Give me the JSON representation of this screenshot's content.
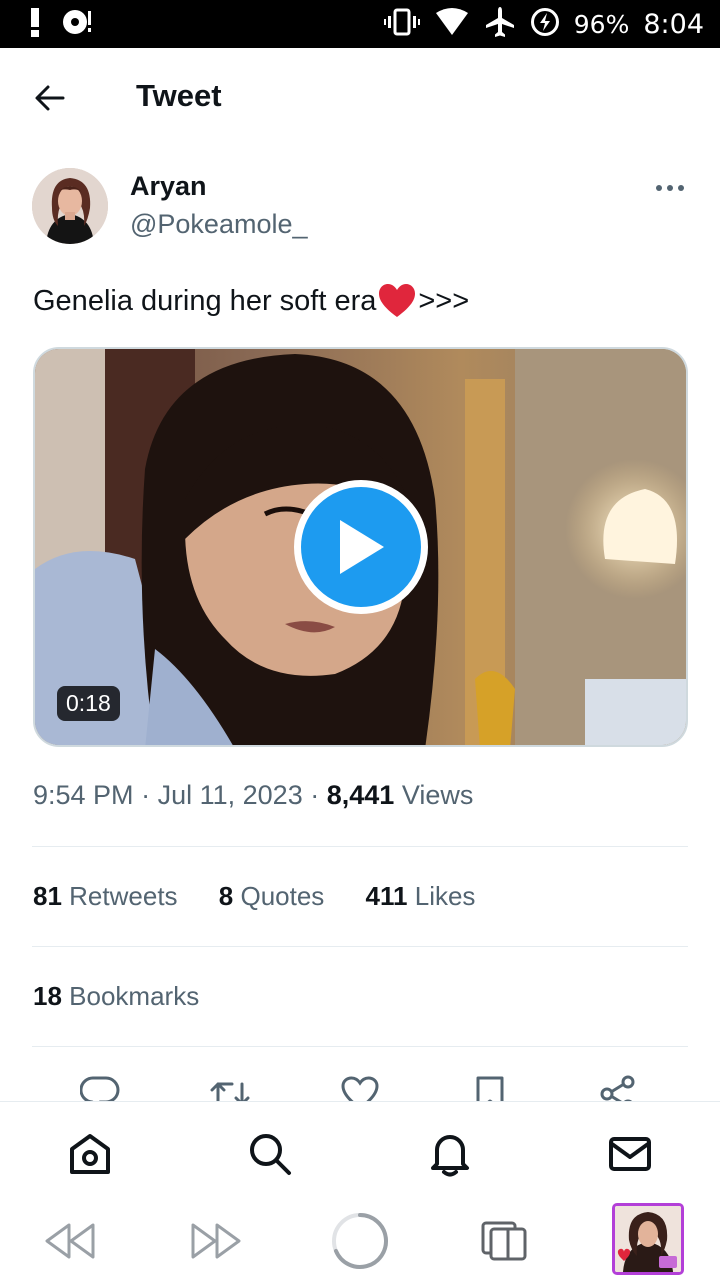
{
  "status_bar": {
    "battery": "96%",
    "time": "8:04",
    "icons": [
      "alert-icon",
      "media-icon",
      "vibrate-icon",
      "wifi-icon",
      "airplane-icon",
      "battery-saver-icon"
    ]
  },
  "header": {
    "title": "Tweet",
    "back_icon": "arrow-left-icon"
  },
  "tweet": {
    "author": {
      "name": "Aryan",
      "handle": "@Pokeamole_"
    },
    "text": "Genelia during her soft era",
    "text_suffix": ">>>",
    "emoji": "red-heart",
    "media": {
      "type": "video",
      "duration": "0:18"
    },
    "time": "9:54 PM",
    "date": "Jul 11, 2023",
    "views_count": "8,441",
    "views_label": "Views",
    "sep": "·"
  },
  "stats": {
    "retweets_count": "81",
    "retweets_label": "Retweets",
    "quotes_count": "8",
    "quotes_label": "Quotes",
    "likes_count": "411",
    "likes_label": "Likes",
    "bookmarks_count": "18",
    "bookmarks_label": "Bookmarks"
  },
  "actions": [
    "reply-icon",
    "retweet-icon",
    "like-icon",
    "bookmark-icon",
    "share-icon"
  ],
  "bottom_nav": [
    "home-icon",
    "search-icon",
    "notifications-icon",
    "messages-icon"
  ],
  "browser_bar": [
    "back-icon",
    "forward-icon",
    "loading-icon",
    "tabs-icon",
    "tab-thumbnail"
  ],
  "colors": {
    "accent": "#1d9bf0",
    "text_primary": "#0f1419",
    "text_secondary": "#536471",
    "heart": "#e0263c",
    "tab_border": "#b33fd8"
  }
}
